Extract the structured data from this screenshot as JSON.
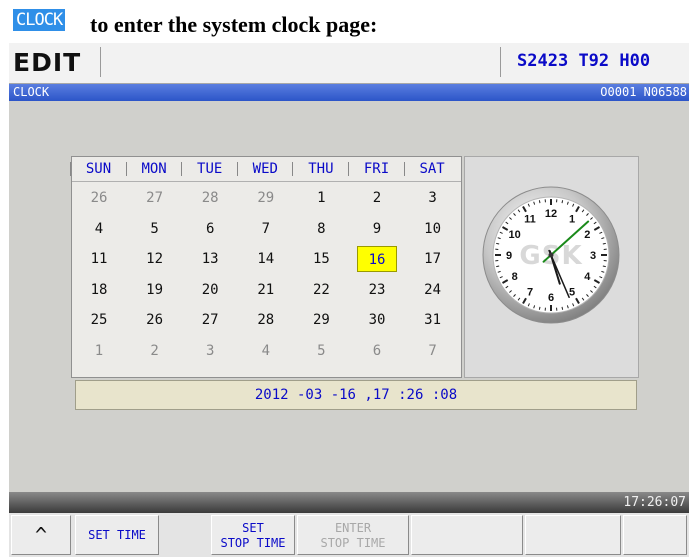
{
  "caption": {
    "key_label": "CLOCK",
    "text": "to enter the system clock page:"
  },
  "topbar": {
    "mode": "EDIT",
    "spindle": "S2423",
    "tool": "T92",
    "h_offset": "H00"
  },
  "titlebar": {
    "page": "CLOCK",
    "program": "O0001 N06588"
  },
  "calendar": {
    "weekdays": [
      "SUN",
      "MON",
      "TUE",
      "WED",
      "THU",
      "FRI",
      "SAT"
    ],
    "weeks": [
      [
        "26",
        "27",
        "28",
        "29",
        "1",
        "2",
        "3"
      ],
      [
        "4",
        "5",
        "6",
        "7",
        "8",
        "9",
        "10"
      ],
      [
        "11",
        "12",
        "13",
        "14",
        "15",
        "16",
        "17"
      ],
      [
        "18",
        "19",
        "20",
        "21",
        "22",
        "23",
        "24"
      ],
      [
        "25",
        "26",
        "27",
        "28",
        "29",
        "30",
        "31"
      ],
      [
        "1",
        "2",
        "3",
        "4",
        "5",
        "6",
        "7"
      ]
    ],
    "today": "16"
  },
  "clock": {
    "numerals": [
      "12",
      "1",
      "2",
      "3",
      "4",
      "5",
      "6",
      "7",
      "8",
      "9",
      "10",
      "11"
    ],
    "watermark": "GSK",
    "time": {
      "hour": 17,
      "minute": 26,
      "second": 8
    }
  },
  "datetime_display": "2012 -03 -16 ,17 :26 :08",
  "status_time": "17:26:07",
  "softkeys": [
    {
      "symbol": "^"
    },
    {
      "label": "SET TIME"
    },
    {
      "line1": "SET",
      "line2": "STOP TIME"
    },
    {
      "line1": "ENTER",
      "line2": "STOP TIME",
      "disabled": true
    },
    {},
    {},
    {},
    {}
  ],
  "colors": {
    "value_blue": "#0a0ac8",
    "title_bar_blue": "#2c55c8",
    "today_highlight": "#ffff00",
    "second_hand": "#1a8a1a"
  }
}
